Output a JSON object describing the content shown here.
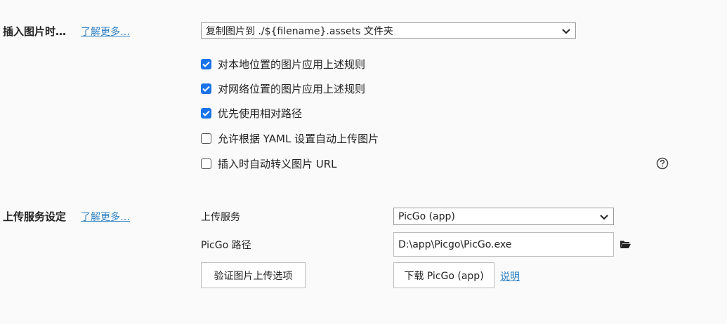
{
  "insert_image": {
    "title": "插入图片时…",
    "learn_more": "了解更多…",
    "dropdown_value": "复制图片到 ./${filename}.assets 文件夹",
    "options": [
      {
        "label": "对本地位置的图片应用上述规则",
        "checked": true
      },
      {
        "label": "对网络位置的图片应用上述规则",
        "checked": true
      },
      {
        "label": "优先使用相对路径",
        "checked": true
      },
      {
        "label": "允许根据 YAML 设置自动上传图片",
        "checked": false
      },
      {
        "label": "插入时自动转义图片 URL",
        "checked": false
      }
    ],
    "help_icon": "help-circle-icon"
  },
  "upload_service": {
    "title": "上传服务设定",
    "learn_more": "了解更多…",
    "service_label": "上传服务",
    "service_value": "PicGo (app)",
    "path_label": "PicGo 路径",
    "path_value": "D:\\app\\Picgo\\PicGo.exe",
    "folder_icon": "folder-icon",
    "verify_button": "验证图片上传选项",
    "download_button": "下载 PicGo (app)",
    "explain_link": "说明"
  },
  "colors": {
    "accent": "#1a73e8",
    "link": "#2f80c4",
    "background": "#fafafa"
  }
}
